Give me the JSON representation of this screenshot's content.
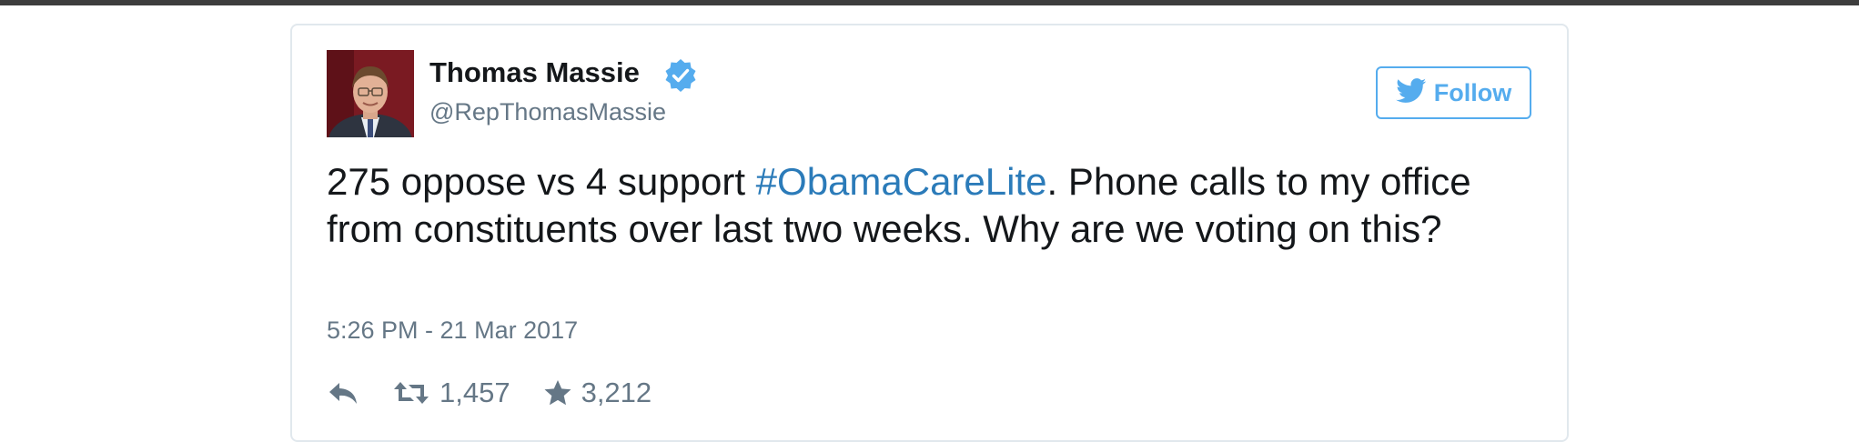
{
  "tweet": {
    "author": {
      "name": "Thomas Massie",
      "handle": "@RepThomasMassie",
      "verified": true
    },
    "follow_label": "Follow",
    "text": {
      "before_hashtag": "275 oppose vs 4 support ",
      "hashtag": "#ObamaCareLite",
      "after_hashtag": ".  Phone calls to my office from constituents over last two weeks.  Why are we voting on this?"
    },
    "timestamp": "5:26 PM - 21 Mar 2017",
    "retweets": "1,457",
    "likes": "3,212"
  },
  "icons": {
    "verified": "verified-badge-icon",
    "follow": "twitter-bird-icon",
    "reply": "reply-icon",
    "retweet": "retweet-icon",
    "like": "star-icon"
  },
  "colors": {
    "brand": "#55acee",
    "hashtag": "#2b7bb9",
    "text": "#14171a",
    "muted": "#657786",
    "border": "#e1e8ed",
    "top_bar": "#3d3d3d"
  }
}
